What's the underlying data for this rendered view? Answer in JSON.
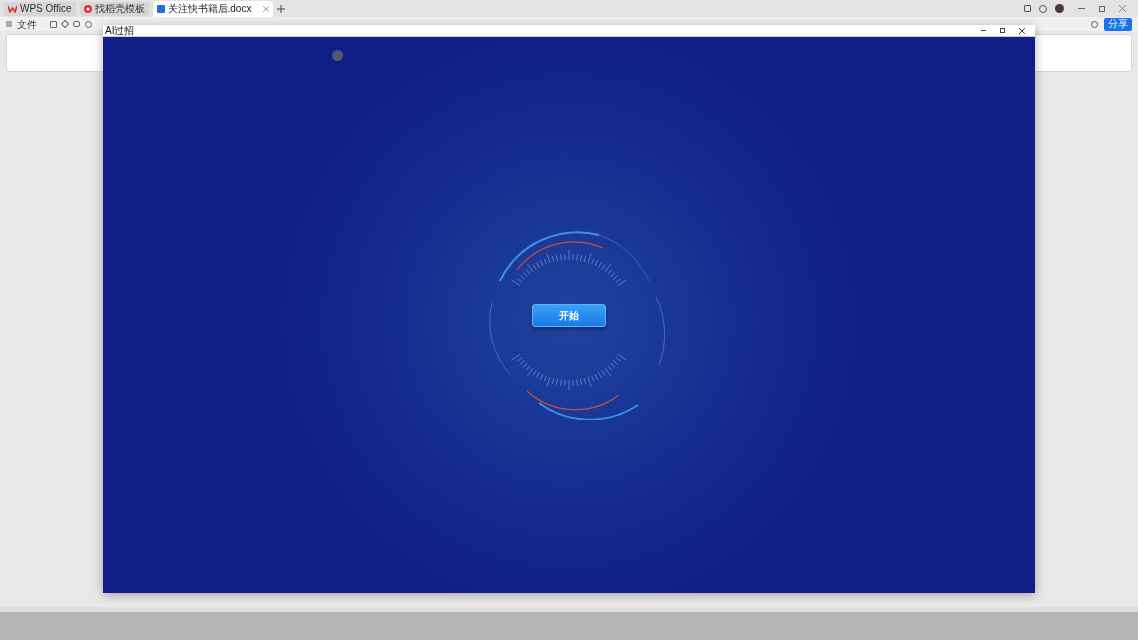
{
  "app_tabs": [
    {
      "label": "WPS Office",
      "kind": "home",
      "selected": false
    },
    {
      "label": "找稻壳模板",
      "kind": "template",
      "selected": false
    },
    {
      "label": "关注快书籍后.docx",
      "kind": "doc",
      "selected": true
    }
  ],
  "toolbar": {
    "file_menu": "文件",
    "share": "分享"
  },
  "dialog": {
    "title": "AI过招",
    "start_button": "开始"
  }
}
